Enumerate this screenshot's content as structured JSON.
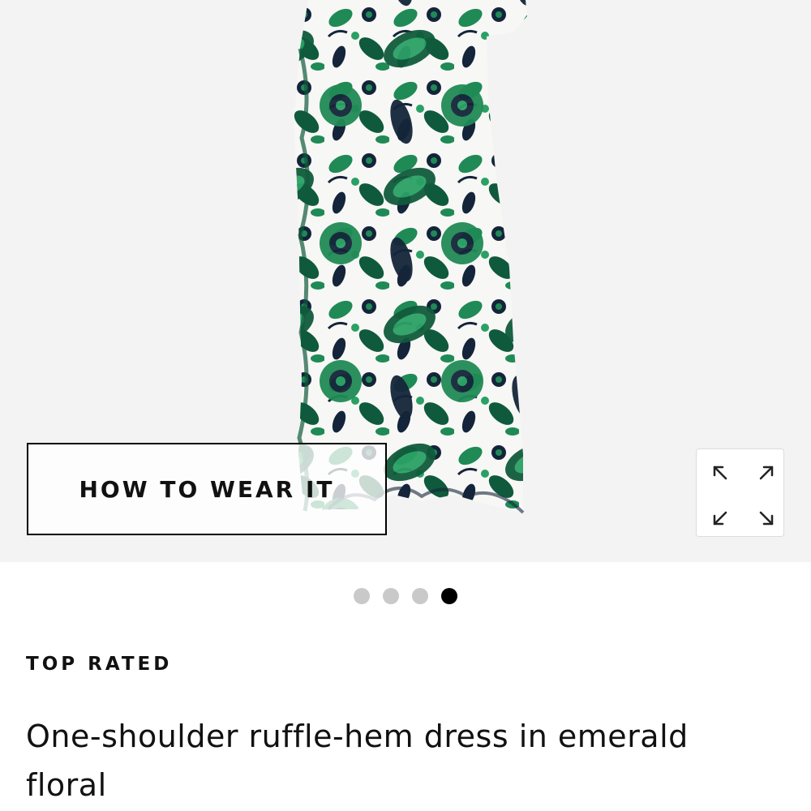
{
  "hero": {
    "how_to_wear_label": "HOW TO WEAR IT",
    "expand_icon": "expand-icon",
    "colors": {
      "background": "#f3f3f3",
      "dress_dark_green": "#0f5a3c",
      "dress_green": "#1f8a55",
      "dress_navy": "#14243a",
      "dress_white": "#f7f7f5"
    }
  },
  "carousel": {
    "total_slides": 4,
    "active_slide": 4
  },
  "product": {
    "badge": "TOP RATED",
    "title": "One-shoulder ruffle-hem dress in emerald floral"
  }
}
